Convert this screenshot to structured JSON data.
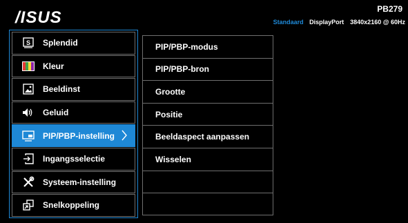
{
  "header": {
    "logo": "/ISUS",
    "model": "PB279",
    "status": {
      "mode": "Standaard",
      "input": "DisplayPort",
      "resolution": "3840x2160 @ 60Hz"
    }
  },
  "main_menu": [
    {
      "label": "Splendid",
      "icon": "splendid-icon"
    },
    {
      "label": "Kleur",
      "icon": "color-icon"
    },
    {
      "label": "Beeldinst",
      "icon": "image-icon"
    },
    {
      "label": "Geluid",
      "icon": "speaker-icon"
    },
    {
      "label": "PIP/PBP-instelling",
      "icon": "pip-icon",
      "active": true
    },
    {
      "label": "Ingangsselectie",
      "icon": "input-icon"
    },
    {
      "label": "Systeem-instelling",
      "icon": "wrench-icon"
    },
    {
      "label": "Snelkoppeling",
      "icon": "shortcut-icon"
    }
  ],
  "sub_menu": [
    "PIP/PBP-modus",
    "PIP/PBP-bron",
    "Grootte",
    "Positie",
    "Beeldaspect aanpassen",
    "Wisselen",
    "",
    ""
  ],
  "colors": {
    "accent": "#1e88d6",
    "background": "#000000",
    "border": "#6f6f6f",
    "text": "#ffffff"
  }
}
